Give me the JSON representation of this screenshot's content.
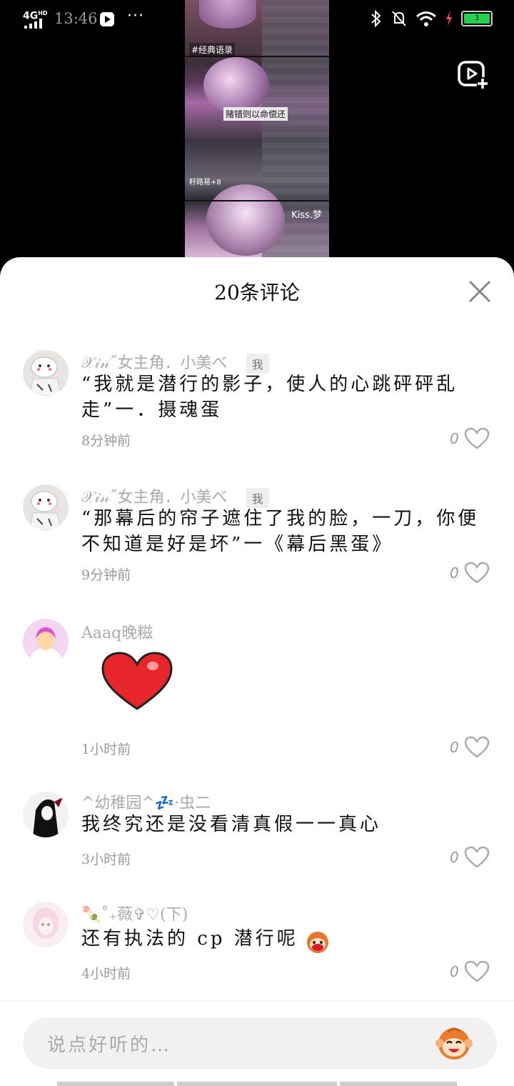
{
  "status": {
    "network": "4G",
    "network_sub": "HD",
    "time": "13:46",
    "dots": "···",
    "battery": "3"
  },
  "video": {
    "tag": "#经典语录",
    "caption1": "赌错则以命偿还",
    "caption2": "籽路易+8",
    "caption3": "Kiss.梦"
  },
  "sheet": {
    "title": "20条评论"
  },
  "comments": [
    {
      "name": "𝒳𝒾𝓃˝女主角．小美べ",
      "badge": "我",
      "text": "“我就是潜行的影子，使人的心跳砰砰乱走”一．摄魂蛋",
      "time": "8分钟前",
      "likes": "0"
    },
    {
      "name": "𝒳𝒾𝓃˝女主角．小美べ",
      "badge": "我",
      "text": "“那幕后的帘子遮住了我的脸，一刀，你便不知道是好是坏”一《幕后黑蛋》",
      "time": "9分钟前",
      "likes": "0"
    },
    {
      "name": "Aaaq晚糍",
      "text": "",
      "time": "1小时前",
      "likes": "0"
    },
    {
      "name": "^幼稚园^💤·虫二",
      "text": "我终究还是没看清真假一一真心",
      "time": "3小时前",
      "likes": "0"
    },
    {
      "name": "🍡˚₊薇✞♡(下)",
      "text": "还有执法的 cp 潜行呢",
      "time": "4小时前",
      "likes": "0"
    }
  ],
  "input": {
    "placeholder": "说点好听的…"
  },
  "icons": {
    "heart_sticker": "red-heart-sticker",
    "emoji": "monkey-face-icon",
    "like": "heart-outline-icon",
    "close": "close-icon",
    "add_video": "add-video-icon"
  }
}
